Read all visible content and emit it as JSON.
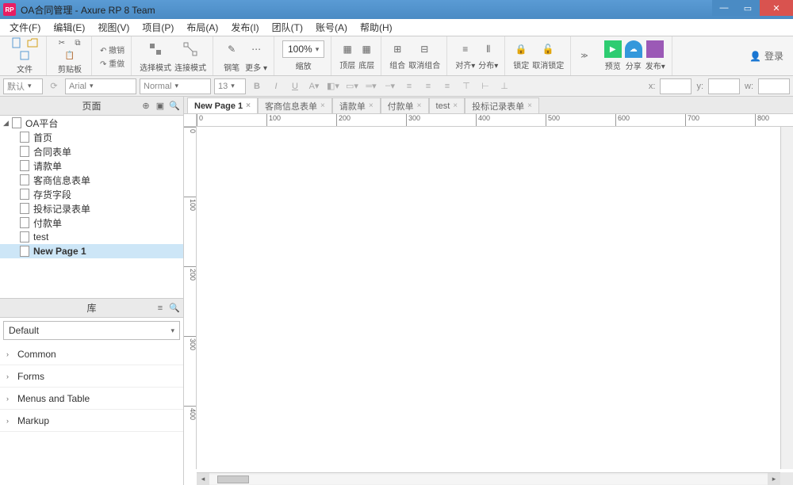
{
  "window": {
    "title": "OA合同管理 - Axure RP 8 Team",
    "app_icon_label": "RP"
  },
  "menu": {
    "items": [
      "文件(F)",
      "编辑(E)",
      "视图(V)",
      "项目(P)",
      "布局(A)",
      "发布(I)",
      "团队(T)",
      "账号(A)",
      "帮助(H)"
    ]
  },
  "toolbar": {
    "file": "文件",
    "clipboard": "剪贴板",
    "undo": "撤销",
    "redo": "重做",
    "select_mode": "选择模式",
    "connect_mode": "连接模式",
    "pen": "钢笔",
    "more": "更多",
    "zoom": "100%",
    "zoom_label": "缩放",
    "top": "顶层",
    "bottom": "底层",
    "group": "组合",
    "ungroup": "取消组合",
    "align": "对齐",
    "distribute": "分布",
    "lock": "锁定",
    "unlock": "取消锁定",
    "preview": "预览",
    "share": "分享",
    "publish": "发布",
    "login": "登录"
  },
  "propbar": {
    "style_default": "默认",
    "font": "Arial",
    "font_family": "Normal",
    "font_size": "13",
    "x_label": "x:",
    "y_label": "y:",
    "w_label": "w:"
  },
  "sidebar": {
    "pages_title": "页面",
    "lib_title": "库",
    "tree": {
      "root": "OA平台",
      "items": [
        "首页",
        "合同表单",
        "请款单",
        "客商信息表单",
        "存货字段",
        "投标记录表单",
        "付款单",
        "test",
        "New Page 1"
      ]
    },
    "lib_default": "Default",
    "lib_categories": [
      "Common",
      "Forms",
      "Menus and Table",
      "Markup"
    ]
  },
  "tabs": {
    "items": [
      "New Page 1",
      "客商信息表单",
      "请款单",
      "付款单",
      "test",
      "投标记录表单"
    ],
    "active_index": 0
  },
  "ruler": {
    "h_ticks": [
      "0",
      "100",
      "200",
      "300",
      "400",
      "500",
      "600",
      "700",
      "800"
    ],
    "v_ticks": [
      "0",
      "100",
      "200",
      "300",
      "400"
    ]
  }
}
